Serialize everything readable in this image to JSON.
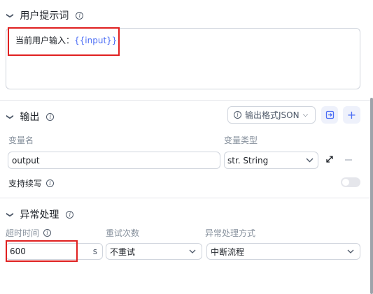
{
  "prompt_section": {
    "title": "用户提示词",
    "line_prefix": "当前用户输入：",
    "variable": "{{input}}"
  },
  "output_section": {
    "title": "输出",
    "format_button": "输出格式JSON",
    "col_var_name": "变量名",
    "col_var_type": "变量类型",
    "var_name_value": "output",
    "var_type_value": "str. String",
    "streaming_label": "支持续写"
  },
  "exception_section": {
    "title": "异常处理",
    "timeout_label": "超时时间",
    "retry_label": "重试次数",
    "method_label": "异常处理方式",
    "timeout_value": "600",
    "timeout_unit": "s",
    "retry_value": "不重试",
    "method_value": "中断流程"
  },
  "colors": {
    "accent": "#4c6ef5",
    "highlight_red": "#e02020",
    "border": "#d0d5dd"
  }
}
